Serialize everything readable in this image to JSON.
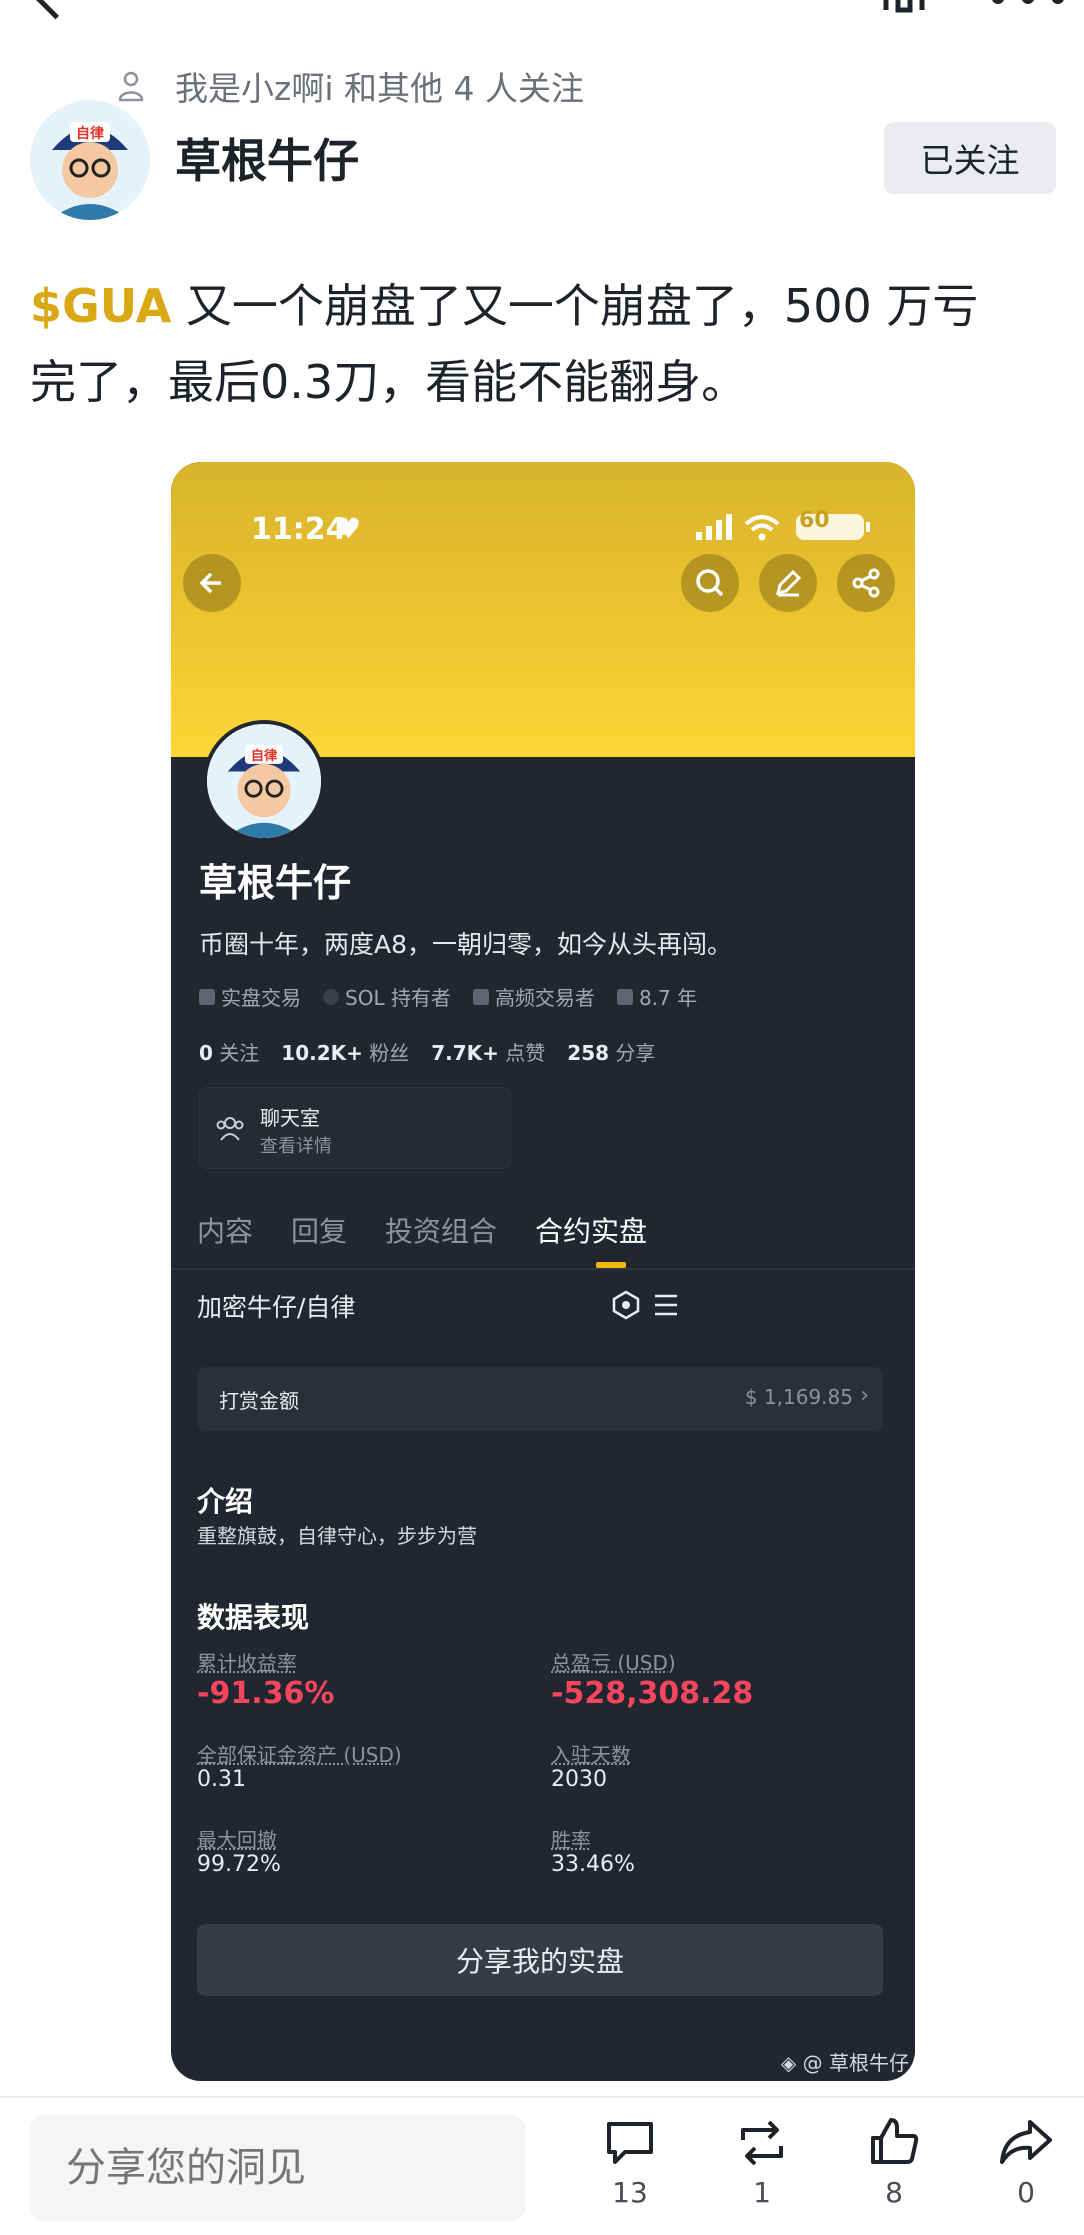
{
  "post": {
    "follow_info": "我是小z啊i 和其他 4 人关注",
    "author": "草根牛仔",
    "follow_button": "已关注",
    "ticker": "$GUA",
    "text_line1": " 又一个崩盘了又一个崩盘了，500 万亏",
    "text_line2": "完了，最后0.3刀，看能不能翻身。"
  },
  "screenshot": {
    "time": "11:24",
    "battery": "60",
    "profile_name": "草根牛仔",
    "bio": "币圈十年，两度A8，一朝归零，如今从头再闯。",
    "avatar_text": "自律",
    "tags": [
      "实盘交易",
      "SOL 持有者",
      "高频交易者",
      "8.7 年"
    ],
    "stats": [
      {
        "value": "0",
        "label": "关注"
      },
      {
        "value": "10.2K+",
        "label": "粉丝"
      },
      {
        "value": "7.7K+",
        "label": "点赞"
      },
      {
        "value": "258",
        "label": "分享"
      }
    ],
    "chat_title": "聊天室",
    "chat_sub": "查看详情",
    "tabs": [
      "内容",
      "回复",
      "投资组合",
      "合约实盘"
    ],
    "account": "加密牛仔/自律",
    "tip_label": "打赏金额",
    "tip_value": "$ 1,169.85",
    "intro_title": "介绍",
    "intro_text": "重整旗鼓，自律守心，步步为营",
    "perf_title": "数据表现",
    "metrics": {
      "cum_return_label": "累计收益率",
      "cum_return_value": "-91.36%",
      "total_pnl_label": "总盈亏 (USD)",
      "total_pnl_value": "-528,308.28",
      "margin_label": "全部保证金资产 (USD)",
      "margin_value": "0.31",
      "days_label": "入驻天数",
      "days_value": "2030",
      "drawdown_label": "最大回撤",
      "drawdown_value": "99.72%",
      "winrate_label": "胜率",
      "winrate_value": "33.46%"
    },
    "share_button": "分享我的实盘",
    "watermark": "@ 草根牛仔"
  },
  "bottom": {
    "input_placeholder": "分享您的洞见",
    "comments": "13",
    "reposts": "1",
    "likes": "8",
    "shares": "0"
  },
  "colors": {
    "accent": "#f0b90b",
    "negative": "#f6465d",
    "ticker": "#d8a914"
  }
}
